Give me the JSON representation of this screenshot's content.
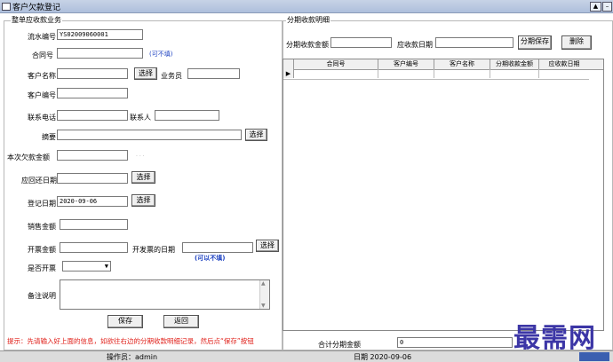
{
  "window": {
    "title": "客户欠款登记"
  },
  "left_group": {
    "title": "整单应收款业务"
  },
  "right_group": {
    "title": "分期收款明细"
  },
  "form": {
    "serial_label": "流水编号",
    "serial_value": "YS02009060001",
    "contract_label": "合同号",
    "contract_hint": "(可不填)",
    "customer_name_label": "客户名称",
    "customer_select": "选择",
    "salesman_label": "业务员",
    "customer_no_label": "客户编号",
    "phone_label": "联系电话",
    "contact_label": "联系人",
    "summary_label": "摘要",
    "summary_select": "选择",
    "amount_label": "本次欠款金额",
    "amount_dots": ". . .",
    "due_date_label": "应回还日期",
    "due_select": "选择",
    "reg_date_label": "登记日期",
    "reg_date_value": "2020-09-06",
    "reg_select": "选择",
    "sales_amount_label": "销售金额",
    "invoice_amount_label": "开票金额",
    "invoice_date_label": "开发票的日期",
    "invoice_select": "选择",
    "invoice_hint": "(可以不填)",
    "is_invoice_label": "是否开票",
    "remark_label": "备注说明",
    "save_btn": "保存",
    "back_btn": "返回",
    "tip": "提示：先请输入好上面的信息，如欲往右边的分期收款明细记录，然后点“保存”按钮"
  },
  "installment": {
    "amount_label": "分期收款金额",
    "date_label": "应收款日期",
    "save_btn": "分期保存",
    "delete_btn": "删除",
    "columns": [
      "合同号",
      "客户编号",
      "客户名称",
      "分期收款金额",
      "应收款日期"
    ],
    "total_label": "合计分期金额",
    "total_value": "0"
  },
  "status": {
    "operator": "操作员：admin",
    "date": "日期 2020-09-06"
  },
  "watermark": "最需网",
  "icons": {
    "row_pointer": "row-pointer-icon",
    "dropdown": "chevron-down-icon"
  }
}
